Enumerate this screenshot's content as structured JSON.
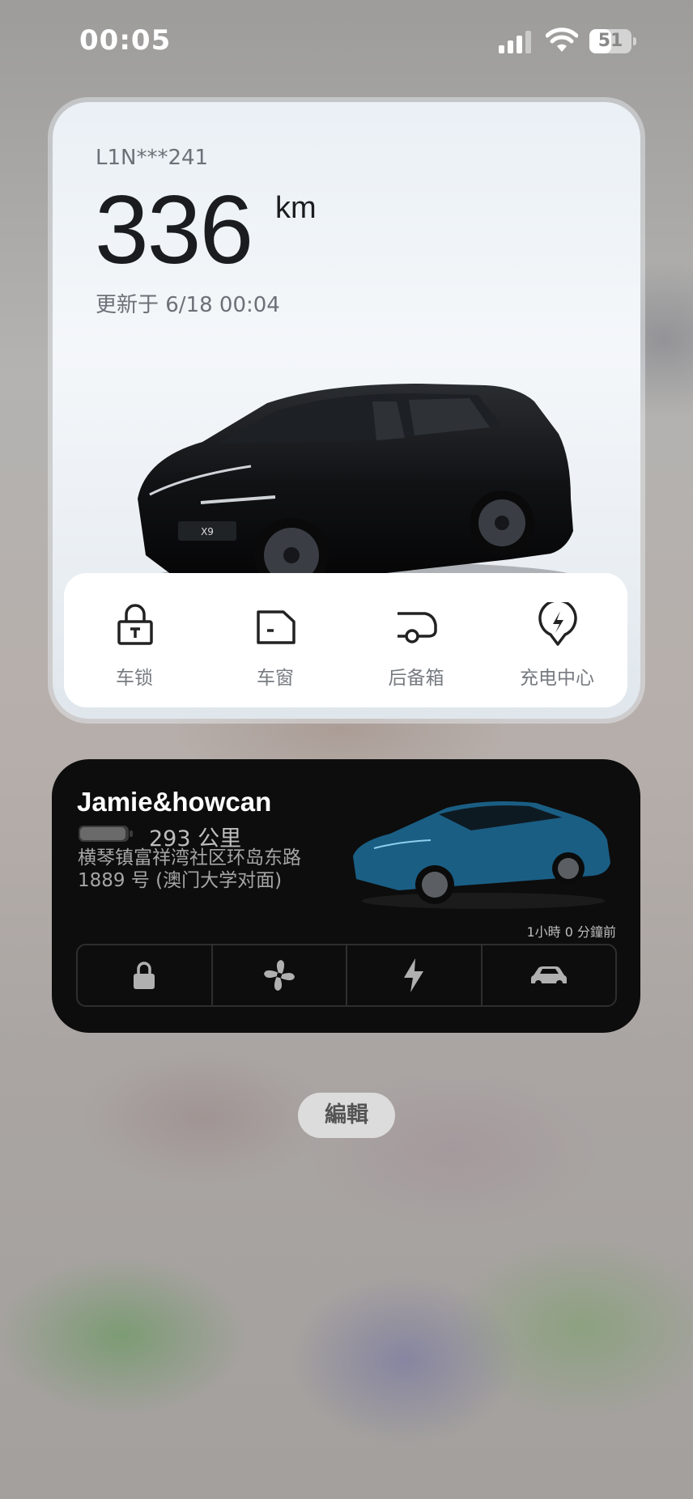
{
  "status_bar": {
    "time": "00:05",
    "battery": "51",
    "battery_level": 0.51
  },
  "xpeng_widget": {
    "plate": "L1N***241",
    "range_value": "336",
    "range_unit": "km",
    "updated": "更新于 6/18 00:04",
    "controls": [
      {
        "label": "车锁",
        "icon": "lock-icon"
      },
      {
        "label": "车窗",
        "icon": "window-icon"
      },
      {
        "label": "后备箱",
        "icon": "trunk-icon"
      },
      {
        "label": "充电中心",
        "icon": "charging-pin-icon"
      }
    ]
  },
  "tesla_widget": {
    "name": "Jamie&howcan",
    "range": "293 公里",
    "address_line1": "横琴镇富祥湾社区环岛东路",
    "address_line2": "1889 号 (澳门大学对面)",
    "updated_ago": "1小時 0 分鐘前",
    "buttons": [
      {
        "icon": "lock-icon"
      },
      {
        "icon": "fan-icon"
      },
      {
        "icon": "lightning-icon"
      },
      {
        "icon": "car-icon"
      }
    ],
    "car_color": "#1a5e84"
  },
  "edit_label": "編輯"
}
